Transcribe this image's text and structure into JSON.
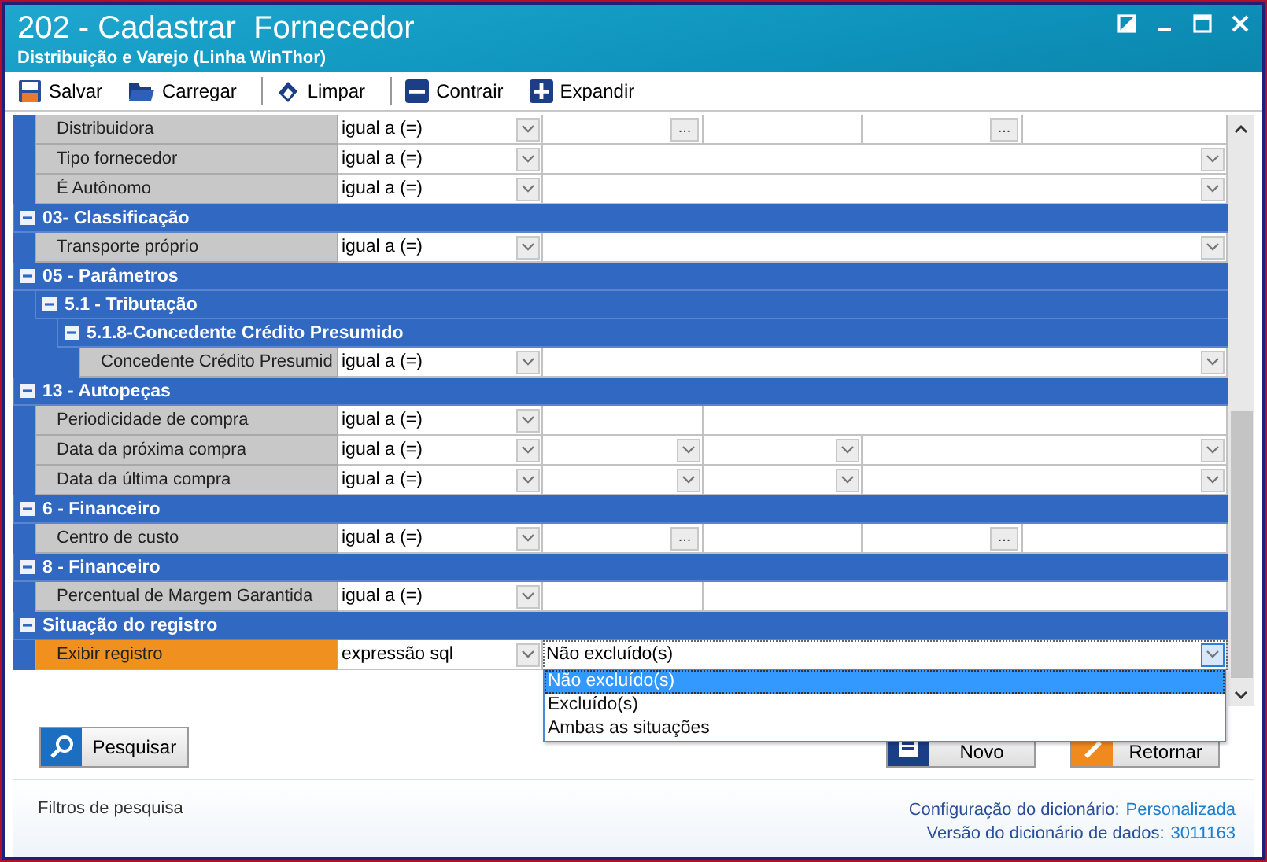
{
  "window": {
    "title": "202 - Cadastrar  Fornecedor",
    "subtitle": "Distribuição e Varejo (Linha WinThor)"
  },
  "toolbar": [
    {
      "kind": "save",
      "label": "Salvar"
    },
    {
      "kind": "open",
      "label": "Carregar"
    },
    {
      "kind": "clear",
      "label": "Limpar"
    },
    {
      "kind": "collapse",
      "label": "Contrair"
    },
    {
      "kind": "expand",
      "label": "Expandir"
    }
  ],
  "filters": [
    {
      "kind": "group",
      "children": [
        {
          "kind": "lookup2",
          "label": "Distribuidora",
          "operator": "igual a (=)",
          "buttons": [
            "...",
            "..."
          ],
          "selected": false
        },
        {
          "kind": "dropdown",
          "label": "Tipo fornecedor",
          "operator": "igual a (=)",
          "selected": false
        },
        {
          "kind": "dropdown",
          "label": "É Autônomo",
          "operator": "igual a (=)",
          "selected": false
        }
      ]
    },
    {
      "kind": "group",
      "label": "03- Classificação",
      "expanded": true,
      "children": [
        {
          "kind": "dropdown",
          "label": "Transporte próprio",
          "operator": "igual a (=)",
          "selected": false
        }
      ]
    },
    {
      "kind": "group",
      "label": "05 - Parâmetros",
      "expanded": true,
      "children": [
        {
          "kind": "group",
          "label": "5.1 - Tributação",
          "expanded": true,
          "children": [
            {
              "kind": "group",
              "label": "5.1.8-Concedente Crédito Presumido",
              "expanded": true,
              "children": [
                {
                  "kind": "dropdown",
                  "label": "Concedente Crédito Presumid",
                  "operator": "igual a (=)",
                  "selected": false
                }
              ]
            }
          ]
        }
      ]
    },
    {
      "kind": "group",
      "label": "13 - Autopeças",
      "expanded": true,
      "children": [
        {
          "kind": "text2",
          "label": "Periodicidade de compra",
          "operator": "igual a (=)",
          "selected": false
        },
        {
          "kind": "date3",
          "label": "Data da próxima compra",
          "operator": "igual a (=)",
          "selected": false
        },
        {
          "kind": "date3",
          "label": "Data da última compra",
          "operator": "igual a (=)",
          "selected": false
        }
      ]
    },
    {
      "kind": "group",
      "label": "6 - Financeiro",
      "expanded": true,
      "children": [
        {
          "kind": "lookup2",
          "label": "Centro de custo",
          "operator": "igual a (=)",
          "buttons": [
            "...",
            "..."
          ],
          "selected": false
        }
      ]
    },
    {
      "kind": "group",
      "label": "8 - Financeiro",
      "expanded": true,
      "children": [
        {
          "kind": "text2",
          "label": "Percentual de Margem Garantida",
          "operator": "igual a (=)",
          "selected": false
        }
      ]
    },
    {
      "kind": "group",
      "label": "Situação do registro",
      "expanded": true,
      "children": [
        {
          "kind": "dropdown",
          "label": "Exibir registro",
          "operator": "expressão sql",
          "value": "Não excluído(s)",
          "selected": true,
          "open": true,
          "options": [
            {
              "label": "Não excluído(s)",
              "selected": true
            },
            {
              "label": "Excluído(s)",
              "selected": false
            },
            {
              "label": "Ambas as situações",
              "selected": false
            }
          ]
        }
      ]
    }
  ],
  "buttons": [
    {
      "kind": "search",
      "label": "Pesquisar"
    },
    {
      "kind": "new",
      "label": "Novo"
    },
    {
      "kind": "back",
      "label": "Retornar"
    }
  ],
  "status_bar": {
    "left": "Filtros de pesquisa",
    "lines": [
      {
        "label": "Configuração do dicionário:",
        "value": "Personalizada"
      },
      {
        "label": "Versão do dicionário de dados:",
        "value": "3011163"
      }
    ]
  }
}
